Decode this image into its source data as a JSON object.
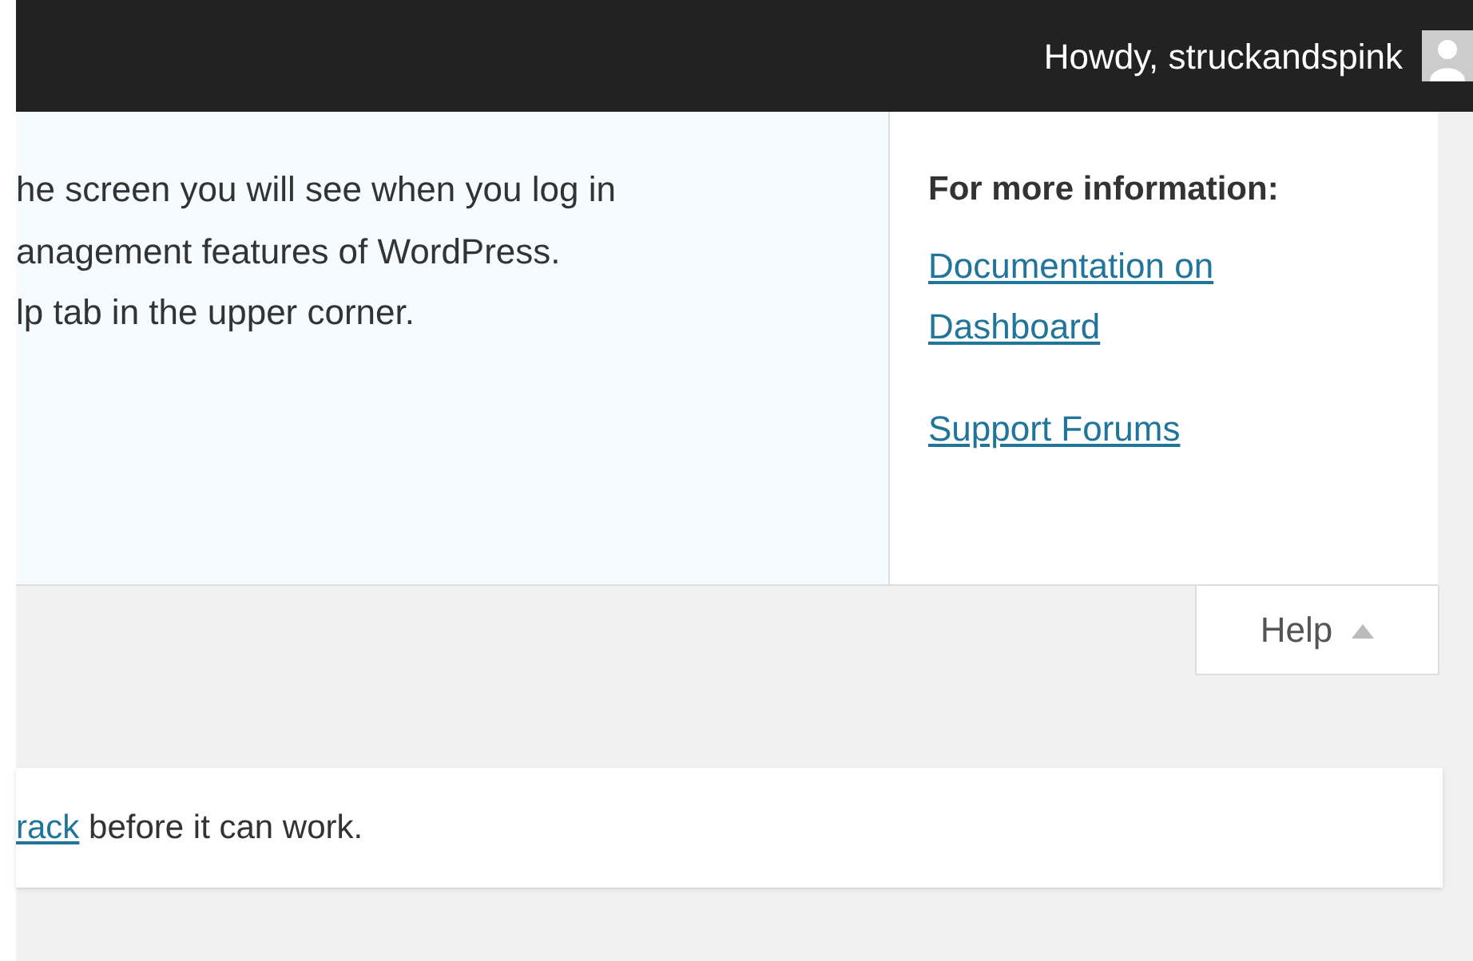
{
  "admin_bar": {
    "greeting": "Howdy, struckandspink"
  },
  "help_panel": {
    "lines": [
      "he screen you will see when you log in",
      "anagement features of WordPress.",
      "lp tab in the upper corner."
    ],
    "sidebar": {
      "heading": "For more information:",
      "links": [
        "Documentation on Dashboard",
        "Support Forums"
      ]
    },
    "tab": {
      "label": "Help",
      "expanded": true
    }
  },
  "notice": {
    "link": "rack",
    "text": " before it can work."
  }
}
